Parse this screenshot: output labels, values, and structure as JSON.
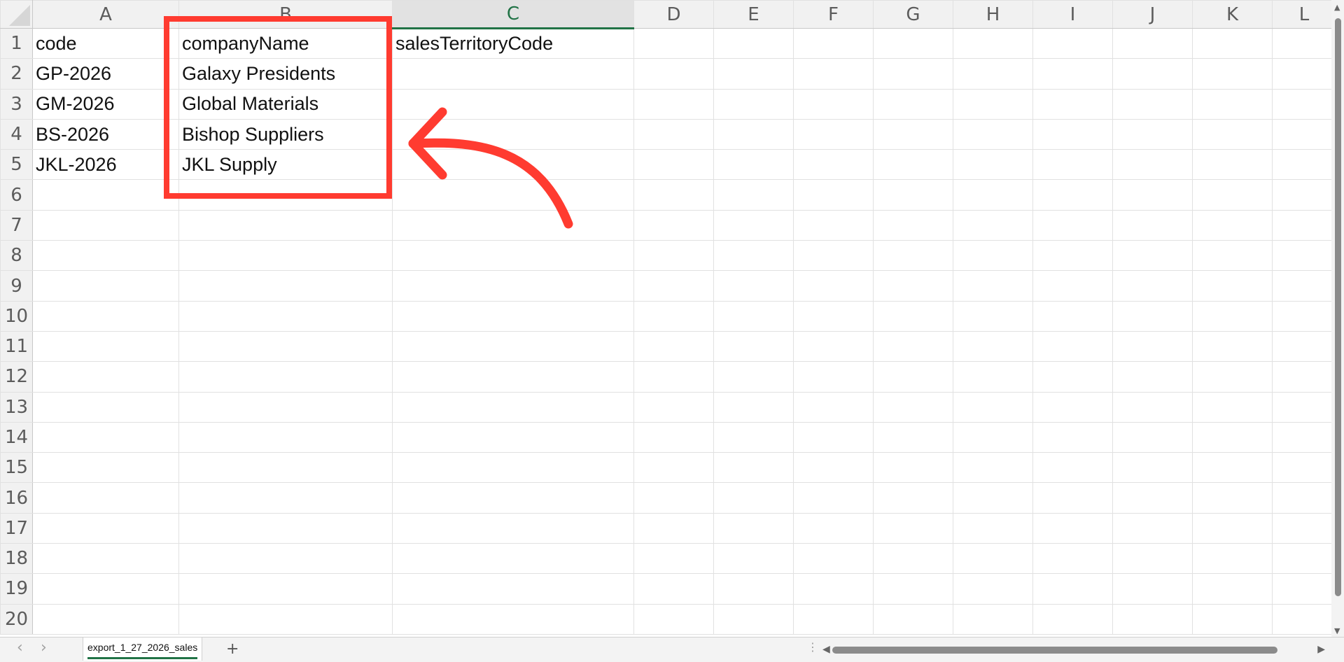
{
  "spreadsheet": {
    "columns": [
      "A",
      "B",
      "C",
      "D",
      "E",
      "F",
      "G",
      "H",
      "I",
      "J",
      "K",
      "L"
    ],
    "active_column": "C",
    "rows": [
      {
        "n": "1",
        "cells": [
          "code",
          "companyName",
          "salesTerritoryCode"
        ]
      },
      {
        "n": "2",
        "cells": [
          "GP-2026",
          "Galaxy Presidents",
          ""
        ]
      },
      {
        "n": "3",
        "cells": [
          "GM-2026",
          "Global Materials",
          ""
        ]
      },
      {
        "n": "4",
        "cells": [
          "BS-2026",
          "Bishop Suppliers",
          ""
        ]
      },
      {
        "n": "5",
        "cells": [
          "JKL-2026",
          "JKL Supply",
          ""
        ]
      },
      {
        "n": "6",
        "cells": []
      },
      {
        "n": "7",
        "cells": []
      },
      {
        "n": "8",
        "cells": []
      },
      {
        "n": "9",
        "cells": []
      },
      {
        "n": "10",
        "cells": []
      },
      {
        "n": "11",
        "cells": []
      },
      {
        "n": "12",
        "cells": []
      },
      {
        "n": "13",
        "cells": []
      },
      {
        "n": "14",
        "cells": []
      },
      {
        "n": "15",
        "cells": []
      },
      {
        "n": "16",
        "cells": []
      },
      {
        "n": "17",
        "cells": []
      },
      {
        "n": "18",
        "cells": []
      },
      {
        "n": "19",
        "cells": []
      },
      {
        "n": "20",
        "cells": []
      }
    ]
  },
  "status_bar": {
    "prev_sheet_icon": "chevron-left-icon",
    "next_sheet_icon": "chevron-right-icon",
    "sheet_tab": "export_1_27_2026_sales",
    "add_sheet_label": "+"
  },
  "annotation": {
    "highlight_color": "#ff3b30",
    "highlight_target": "column B",
    "arrow_icon": "curved-arrow-icon"
  }
}
